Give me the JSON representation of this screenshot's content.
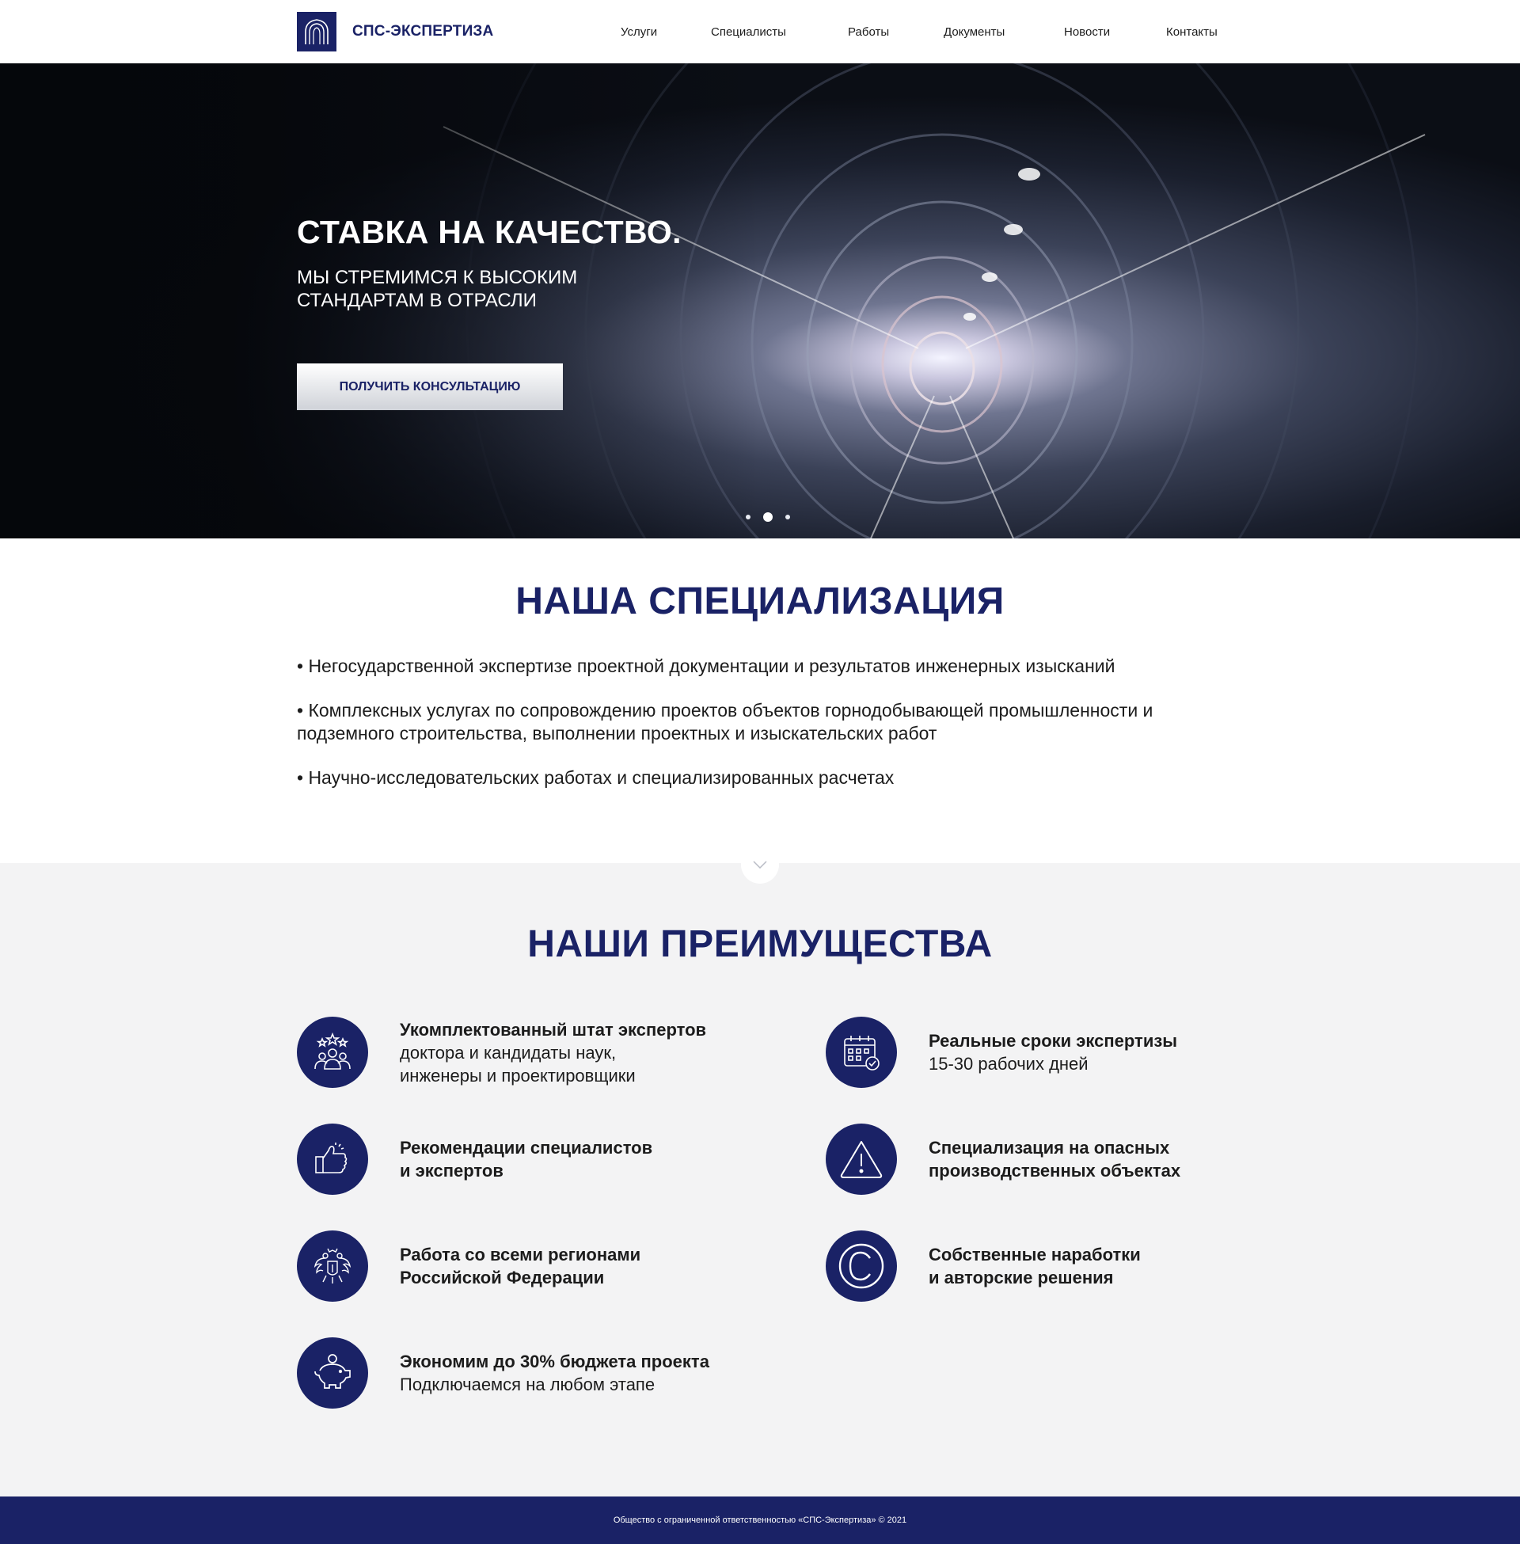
{
  "brand": {
    "name": "СПС-ЭКСПЕРТИЗА",
    "logo_icon": "arch-icon",
    "primary_color": "#1a2266"
  },
  "nav": {
    "items": [
      "Услуги",
      "Специалисты",
      "Работы",
      "Документы",
      "Новости",
      "Контакты"
    ]
  },
  "hero": {
    "title": "СТАВКА НА КАЧЕСТВО.",
    "subtitle_lines": [
      "МЫ СТРЕМИМСЯ К ВЫСОКИМ",
      "СТАНДАРТАМ В ОТРАСЛИ"
    ],
    "cta_label": "ПОЛУЧИТЬ КОНСУЛЬТАЦИЮ",
    "slides_total": 3,
    "active_slide": 2
  },
  "specialization": {
    "title": "НАША СПЕЦИАЛИЗАЦИЯ",
    "items": [
      "• Негосударственной экспертизе проектной документации и результатов инженерных изысканий",
      "• Комплексных услугах по сопровождению проектов объектов горнодобывающей промышленности и подземного строительства, выполнении проектных и изыскательских работ",
      "• Научно-исследовательских работах и специализированных расчетах"
    ]
  },
  "advantages": {
    "title": "НАШИ ПРЕИМУЩЕСТВА",
    "items": [
      {
        "icon": "experts-icon",
        "title": "Укомплектованный штат экспертов",
        "desc": [
          "доктора и кандидаты наук,",
          "инженеры и проектировщики"
        ]
      },
      {
        "icon": "calendar-icon",
        "title": "Реальные сроки экспертизы",
        "desc": [
          "15-30 рабочих дней"
        ]
      },
      {
        "icon": "thumbs-up-icon",
        "title": "Рекомендации специалистов",
        "desc": [],
        "title2": "и экспертов"
      },
      {
        "icon": "warning-icon",
        "title": "Специализация на опасных",
        "desc": [],
        "title2": "производственных объектах"
      },
      {
        "icon": "coat-of-arms-icon",
        "title": "Работа со всеми регионами",
        "desc": [],
        "title2": "Российской Федерации"
      },
      {
        "icon": "copyright-icon",
        "title": "Собственные наработки",
        "desc": [],
        "title2": "и авторские решения"
      },
      {
        "icon": "piggy-bank-icon",
        "title": "Экономим до 30% бюджета проекта",
        "desc": [
          "Подключаемся на любом этапе"
        ]
      }
    ]
  },
  "footer": {
    "text": "Общество с ограниченной ответственностью «СПС-Экспертиза»   © 2021"
  }
}
